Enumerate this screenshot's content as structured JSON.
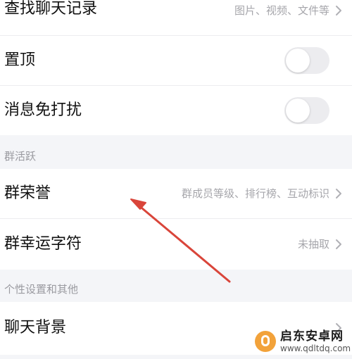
{
  "settings": {
    "items": [
      {
        "label": "查找聊天记录",
        "value": "图片、视频、文件等"
      },
      {
        "label": "置顶",
        "toggle": false
      },
      {
        "label": "消息免打扰",
        "toggle": false
      }
    ],
    "group_activity": {
      "header": "群活跃",
      "items": [
        {
          "label": "群荣誉",
          "value": "群成员等级、排行榜、互动标识"
        },
        {
          "label": "群幸运字符",
          "value": "未抽取"
        }
      ]
    },
    "personal": {
      "header": "个性设置和其他",
      "items": [
        {
          "label": "聊天背景"
        }
      ]
    }
  },
  "annotation": {
    "arrow_color": "#d9453a",
    "icon": "arrow-icon"
  },
  "watermark": {
    "title": "启东安卓网",
    "url": "www.qdltdq.com",
    "badge_color": "#f2a23a"
  },
  "colors": {
    "background": "#f4f5f8",
    "row": "#ffffff",
    "text": "#111111",
    "secondary_text": "#a6a6ab",
    "toggle_off": "#ececef"
  }
}
